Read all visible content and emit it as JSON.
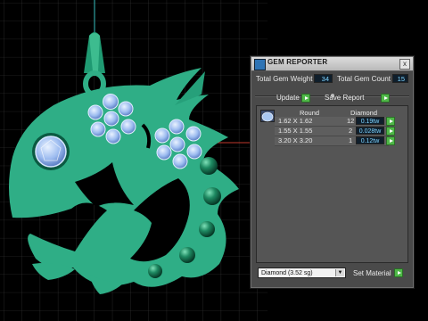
{
  "panel": {
    "title": "GEM REPORTER",
    "close_glyph": "x",
    "total_weight_label": "Total Gem Weight",
    "total_weight_value": "34",
    "total_count_label": "Total Gem Count",
    "total_count_value": "15",
    "update_label": "Update",
    "save_report_label": "Save Report",
    "table": {
      "col_shape": "Round",
      "col_material": "Diamond",
      "rows": [
        {
          "size": "1.62 X 1.62",
          "count": "12",
          "weight": "0.19tw"
        },
        {
          "size": "1.55 X 1.55",
          "count": "2",
          "weight": "0.028tw"
        },
        {
          "size": "3.20 X 3.20",
          "count": "1",
          "weight": "0.12tw"
        }
      ]
    },
    "material_select_value": "Diamond    (3.52 sg)",
    "set_material_label": "Set Material"
  },
  "colors": {
    "pendant": "#2fae86",
    "gem": "#a9c8f2",
    "bead": "#1e7a5a",
    "grid": "#4a4a4a",
    "accent_play": "#4fb848"
  },
  "icons": [
    "app-icon",
    "close-icon",
    "play-icon",
    "chevron-down-icon",
    "gem-thumbnail-icon"
  ]
}
